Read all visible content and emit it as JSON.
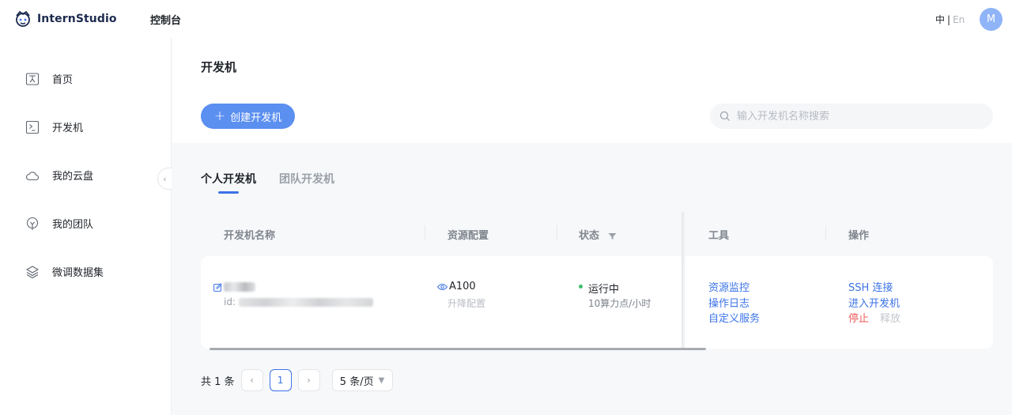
{
  "header": {
    "logo_text": "InternStudio",
    "console_label": "控制台",
    "lang_zh": "中",
    "lang_sep": "|",
    "lang_en": "En",
    "avatar_initial": "M"
  },
  "sidebar": {
    "items": [
      {
        "label": "首页",
        "icon": "home-icon"
      },
      {
        "label": "开发机",
        "icon": "terminal-icon"
      },
      {
        "label": "我的云盘",
        "icon": "cloud-icon"
      },
      {
        "label": "我的团队",
        "icon": "team-icon"
      },
      {
        "label": "微调数据集",
        "icon": "layers-icon"
      }
    ],
    "collapse_glyph": "‹"
  },
  "main": {
    "title": "开发机",
    "create_button": {
      "plus": "+",
      "label": "创建开发机"
    },
    "search": {
      "placeholder": "输入开发机名称搜索"
    },
    "tabs": [
      {
        "label": "个人开发机",
        "active": true
      },
      {
        "label": "团队开发机",
        "active": false
      }
    ],
    "table": {
      "columns": [
        "开发机名称",
        "资源配置",
        "状态",
        "工具",
        "操作"
      ],
      "rows": [
        {
          "id_prefix": "id:",
          "resource": "A100",
          "upgrade": "升降配置",
          "status": "运行中",
          "status_detail": "10算力点/小时",
          "tools": [
            "资源监控",
            "操作日志",
            "自定义服务"
          ],
          "ops": {
            "ssh": "SSH 连接",
            "enter": "进入开发机",
            "stop": "停止",
            "release": "释放"
          }
        }
      ]
    },
    "pagination": {
      "total": "共 1 条",
      "prev": "‹",
      "current": "1",
      "next": "›",
      "page_size": "5 条/页"
    }
  },
  "colors": {
    "accent": "#3b73e6",
    "primary_button": "#5b8ff0",
    "danger": "#f05a5a",
    "running": "#3fbf6a"
  }
}
